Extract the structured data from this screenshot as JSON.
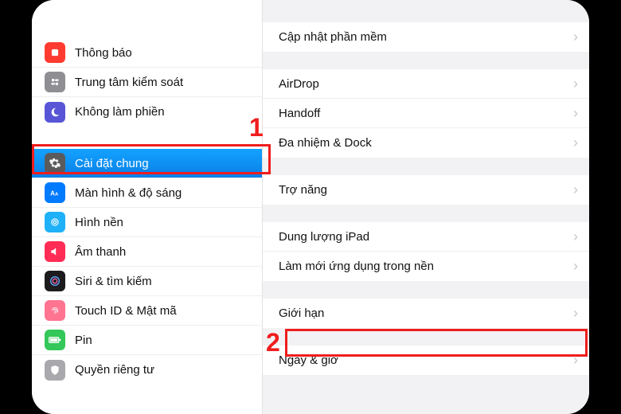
{
  "annotations": {
    "step1": "1",
    "step2": "2"
  },
  "sidebar": {
    "items": [
      {
        "label": "Thông báo",
        "icon": "notification-icon",
        "color": "ic-red"
      },
      {
        "label": "Trung tâm kiểm soát",
        "icon": "control-center-icon",
        "color": "ic-gray"
      },
      {
        "label": "Không làm phiền",
        "icon": "moon-icon",
        "color": "ic-purple"
      },
      {
        "label": "Cài đặt chung",
        "icon": "gear-icon",
        "color": "ic-dgray",
        "selected": true
      },
      {
        "label": "Màn hình & độ sáng",
        "icon": "text-size-icon",
        "color": "ic-blue"
      },
      {
        "label": "Hình nền",
        "icon": "wallpaper-icon",
        "color": "ic-cyan"
      },
      {
        "label": "Âm thanh",
        "icon": "sound-icon",
        "color": "ic-pink"
      },
      {
        "label": "Siri & tìm kiếm",
        "icon": "siri-icon",
        "color": "ic-black"
      },
      {
        "label": "Touch ID & Mật mã",
        "icon": "fingerprint-icon",
        "color": "ic-tpink"
      },
      {
        "label": "Pin",
        "icon": "battery-icon",
        "color": "ic-green"
      },
      {
        "label": "Quyền riêng tư",
        "icon": "privacy-icon",
        "color": "ic-lgray"
      }
    ]
  },
  "detail": {
    "groups": [
      [
        {
          "label": "Cập nhật phần mềm"
        }
      ],
      [
        {
          "label": "AirDrop"
        },
        {
          "label": "Handoff"
        },
        {
          "label": "Đa nhiệm & Dock"
        }
      ],
      [
        {
          "label": "Trợ năng"
        }
      ],
      [
        {
          "label": "Dung lượng iPad"
        },
        {
          "label": "Làm mới ứng dụng trong nền"
        }
      ],
      [
        {
          "label": "Giới hạn"
        }
      ],
      [
        {
          "label": "Ngày & giờ"
        }
      ]
    ]
  }
}
